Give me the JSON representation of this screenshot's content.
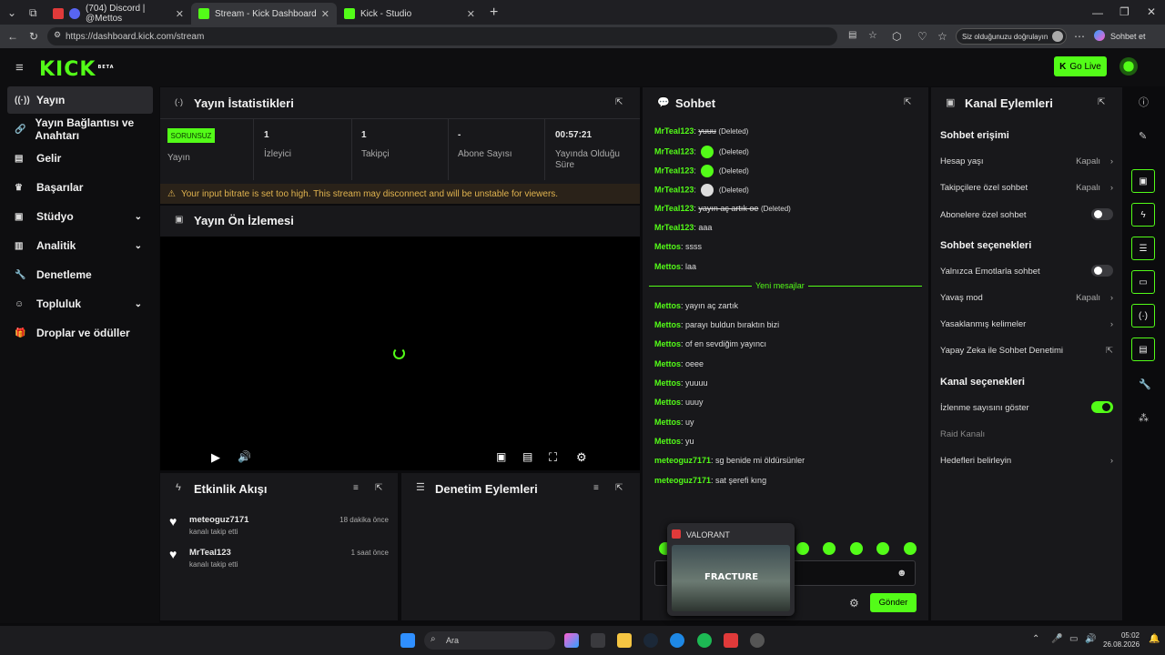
{
  "browser": {
    "tabs": [
      {
        "label": "(704) Discord | @Mettos",
        "active": false
      },
      {
        "label": "Stream - Kick Dashboard",
        "active": true
      },
      {
        "label": "Kick - Studio",
        "active": false
      }
    ],
    "url": "https://dashboard.kick.com/stream",
    "verify_label": "Siz olduğunuzu doğrulayın",
    "copilot_label": "Sohbet et"
  },
  "header": {
    "logo": "KICK",
    "logo_badge": "BETA",
    "go_live": "Go Live"
  },
  "sidebar": {
    "items": [
      {
        "label": "Yayın",
        "icon": "broadcast-icon",
        "active": true
      },
      {
        "label": "Yayın Bağlantısı ve Anahtarı",
        "icon": "link-icon"
      },
      {
        "label": "Gelir",
        "icon": "chart-icon"
      },
      {
        "label": "Başarılar",
        "icon": "trophy-icon"
      },
      {
        "label": "Stüdyo",
        "icon": "studio-icon",
        "expandable": true
      },
      {
        "label": "Analitik",
        "icon": "analytics-icon",
        "expandable": true
      },
      {
        "label": "Denetleme",
        "icon": "wrench-icon"
      },
      {
        "label": "Topluluk",
        "icon": "community-icon",
        "expandable": true
      },
      {
        "label": "Droplar ve ödüller",
        "icon": "gift-icon"
      }
    ]
  },
  "stats": {
    "title": "Yayın İstatistikleri",
    "badge": "SORUNSUZ",
    "badge_label": "Yayın",
    "viewers_value": "1",
    "viewers_label": "İzleyici",
    "followers_value": "1",
    "followers_label": "Takipçi",
    "subs_value": "-",
    "subs_label": "Abone Sayısı",
    "uptime_value": "00:57:21",
    "uptime_label": "Yayında Olduğu Süre",
    "warning": "Your input bitrate is set too high. This stream may disconnect and will be unstable for viewers."
  },
  "preview": {
    "title": "Yayın Ön İzlemesi"
  },
  "activity": {
    "title": "Etkinlik Akışı",
    "items": [
      {
        "user": "meteoguz7171",
        "action": "kanalı takip etti",
        "time": "18 dakika önce"
      },
      {
        "user": "MrTeal123",
        "action": "kanalı takip etti",
        "time": "1 saat önce"
      }
    ]
  },
  "moderation": {
    "title": "Denetim Eylemleri"
  },
  "chat": {
    "title": "Sohbet",
    "deleted_label": "(Deleted)",
    "messages_old": [
      {
        "user": "MrTeal123",
        "text": "yuuu",
        "deleted": true
      },
      {
        "user": "MrTeal123",
        "text": "",
        "deleted": true,
        "emote": true
      },
      {
        "user": "MrTeal123",
        "text": "",
        "deleted": true,
        "emote": true
      },
      {
        "user": "MrTeal123",
        "text": "",
        "deleted": true,
        "emote": true
      },
      {
        "user": "MrTeal123",
        "text": "yayın aç artık oe",
        "deleted": true
      },
      {
        "user": "MrTeal123",
        "text": "aaa"
      },
      {
        "user": "Mettos",
        "text": "ssss"
      },
      {
        "user": "Mettos",
        "text": "laa"
      }
    ],
    "new_divider": "Yeni mesajlar",
    "messages_new": [
      {
        "user": "Mettos",
        "text": "yayın aç zartık"
      },
      {
        "user": "Mettos",
        "text": "parayı buldun bıraktın bizi"
      },
      {
        "user": "Mettos",
        "text": "of en sevdiğim yayıncı"
      },
      {
        "user": "Mettos",
        "text": "oeee"
      },
      {
        "user": "Mettos",
        "text": "yuuuu"
      },
      {
        "user": "Mettos",
        "text": "uuuy"
      },
      {
        "user": "Mettos",
        "text": "uy"
      },
      {
        "user": "Mettos",
        "text": "yu"
      },
      {
        "user": "meteoguz7171",
        "text": "sg benide mi öldürsünler"
      },
      {
        "user": "meteoguz7171",
        "text": "sat şerefi kıng"
      }
    ],
    "send_label": "Gönder"
  },
  "popup": {
    "app": "VALORANT",
    "map": "FRACTURE"
  },
  "channel_actions": {
    "title": "Kanal Eylemleri",
    "chat_access_title": "Sohbet erişimi",
    "account_age": {
      "label": "Hesap yaşı",
      "value": "Kapalı"
    },
    "followers_only": {
      "label": "Takipçilere özel sohbet",
      "value": "Kapalı"
    },
    "subs_only": {
      "label": "Abonelere özel sohbet",
      "on": false
    },
    "chat_options_title": "Sohbet seçenekleri",
    "emote_only": {
      "label": "Yalnızca Emotlarla sohbet",
      "on": false
    },
    "slow_mode": {
      "label": "Yavaş mod",
      "value": "Kapalı"
    },
    "banned_words": {
      "label": "Yasaklanmış kelimeler"
    },
    "ai_moderation": {
      "label": "Yapay Zeka ile Sohbet Denetimi"
    },
    "channel_options_title": "Kanal seçenekleri",
    "show_viewers": {
      "label": "İzlenme sayısını göster",
      "on": true
    },
    "raid_channel": {
      "label": "Raid Kanalı"
    },
    "set_goals": {
      "label": "Hedefleri belirleyin"
    }
  },
  "taskbar": {
    "search_placeholder": "Ara",
    "time": "05:02",
    "date": "26.08.2026"
  },
  "colors": {
    "accent": "#53fc18",
    "panel": "#18181b",
    "background": "#0b0b0d"
  }
}
